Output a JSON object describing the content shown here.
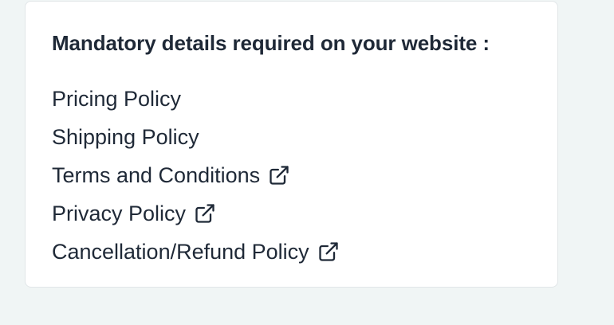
{
  "card": {
    "heading": "Mandatory details required on your website :",
    "items": [
      {
        "label": "Pricing Policy",
        "icon": ""
      },
      {
        "label": "Shipping Policy",
        "icon": ""
      },
      {
        "label": "Terms and Conditions",
        "icon": "external-link-icon"
      },
      {
        "label": "Privacy Policy",
        "icon": "external-link-icon"
      },
      {
        "label": "Cancellation/Refund Policy",
        "icon": "external-link-icon"
      }
    ]
  },
  "colors": {
    "page_background": "#f0f5f5",
    "card_background": "#ffffff",
    "text": "#1f2937"
  }
}
